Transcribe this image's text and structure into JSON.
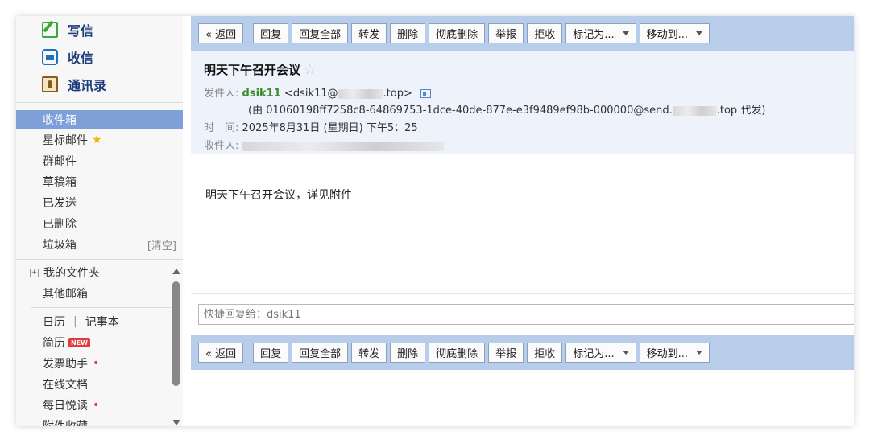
{
  "sidebar": {
    "main_buttons": [
      {
        "label": "写信",
        "icon": "compose-icon"
      },
      {
        "label": "收信",
        "icon": "inbox-icon"
      },
      {
        "label": "通讯录",
        "icon": "contacts-icon"
      }
    ],
    "folders": {
      "inbox": "收件箱",
      "starred": "星标邮件",
      "group": "群邮件",
      "drafts": "草稿箱",
      "sent": "已发送",
      "deleted": "已删除",
      "spam": "垃圾箱",
      "spam_clear": "[清空]",
      "my_folders": "我的文件夹",
      "other_mailboxes": "其他邮箱",
      "calendar": "日历",
      "notes": "记事本",
      "resume": "简历",
      "resume_badge": "NEW",
      "invoice": "发票助手",
      "docs": "在线文档",
      "daily_read": "每日悦读",
      "attachments": "附件收藏"
    }
  },
  "toolbar": {
    "back": "« 返回",
    "reply": "回复",
    "reply_all": "回复全部",
    "forward": "转发",
    "delete": "删除",
    "delete_permanent": "彻底删除",
    "report": "举报",
    "reject": "拒收",
    "mark_as": "标记为...",
    "move_to": "移动到..."
  },
  "email": {
    "subject": "明天下午召开会议",
    "from_label": "发件人:",
    "from_name": "dsik11",
    "from_addr_prefix": "<dsik11@",
    "from_addr_suffix": ".top>",
    "via_prefix": "(由 01060198ff7258c8-64869753-1dce-40de-877e-e3f9489ef98b-000000@send.",
    "via_suffix": ".top 代发)",
    "time_label": "时　间:",
    "time_value": "2025年8月31日 (星期日) 下午5：25",
    "to_label": "收件人:",
    "body": "明天下午召开会议，详见附件"
  },
  "quick_reply": {
    "placeholder": "快捷回复给：dsik11"
  },
  "colors": {
    "toolbar_bg": "#b8cdea",
    "header_bg": "#eef3fb",
    "active_folder": "#7f9fd9",
    "sender_green": "#3a8a2a",
    "badge_red": "#e23b3b"
  }
}
